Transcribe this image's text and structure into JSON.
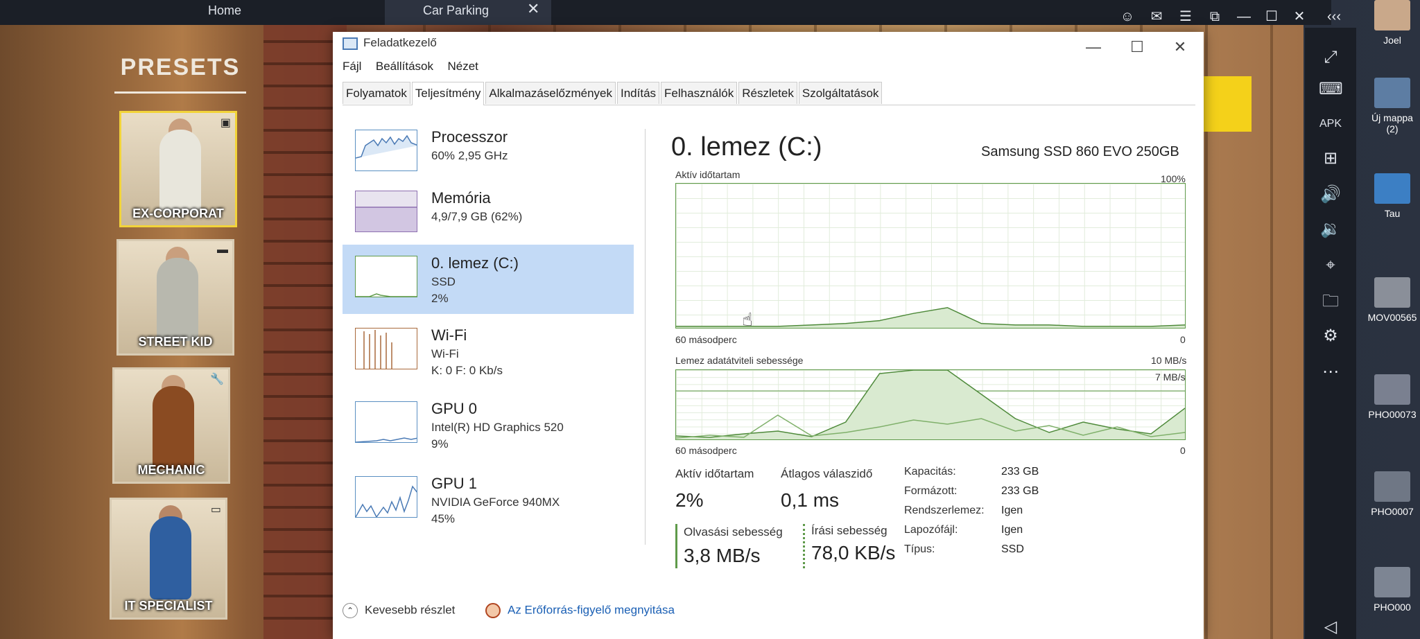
{
  "emulator": {
    "tab_home": "Home",
    "tab_game": "Car Parking",
    "close_glyph": "✕",
    "controls": [
      "☺",
      "✉",
      "☰",
      "⧉",
      "—",
      "☐",
      "✕",
      "‹‹‹"
    ]
  },
  "desktop_icons": [
    {
      "label": "Joel"
    },
    {
      "label": "Új mappa (2)"
    },
    {
      "label": "Tau"
    },
    {
      "label": "MOV00565"
    },
    {
      "label": "PHO00073"
    },
    {
      "label": "PHO0007"
    },
    {
      "label": "PHO000"
    }
  ],
  "game": {
    "presets_title": "PRESETS",
    "presets": [
      {
        "label": "EX-CORPORAT"
      },
      {
        "label": "STREET KID"
      },
      {
        "label": "MECHANIC"
      },
      {
        "label": "IT SPECIALIST"
      }
    ]
  },
  "taskmanager": {
    "title": "Feladatkezelő",
    "menu": [
      "Fájl",
      "Beállítások",
      "Nézet"
    ],
    "tabs": [
      "Folyamatok",
      "Teljesítmény",
      "Alkalmazáselőzmények",
      "Indítás",
      "Felhasználók",
      "Részletek",
      "Szolgáltatások"
    ],
    "active_tab": "Teljesítmény",
    "resources": [
      {
        "name": "Processzor",
        "sub": "60% 2,95 GHz",
        "sub2": ""
      },
      {
        "name": "Memória",
        "sub": "4,9/7,9 GB (62%)",
        "sub2": ""
      },
      {
        "name": "0. lemez (C:)",
        "sub": "SSD",
        "sub2": "2%"
      },
      {
        "name": "Wi-Fi",
        "sub": "Wi-Fi",
        "sub2": "K: 0 F: 0 Kb/s"
      },
      {
        "name": "GPU 0",
        "sub": "Intel(R) HD Graphics 520",
        "sub2": "9%"
      },
      {
        "name": "GPU 1",
        "sub": "NVIDIA GeForce 940MX",
        "sub2": "45%"
      }
    ],
    "selected_resource": 2,
    "detail": {
      "title": "0. lemez (C:)",
      "model": "Samsung SSD 860 EVO 250GB",
      "chart1_label": "Aktív időtartam",
      "chart1_max": "100%",
      "chart1_left": "60 másodperc",
      "chart1_right": "0",
      "chart2_label": "Lemez adatátviteli sebessége",
      "chart2_max": "10 MB/s",
      "chart2_line": "7 MB/s",
      "chart2_left": "60 másodperc",
      "chart2_right": "0",
      "active_label": "Aktív időtartam",
      "active_value": "2%",
      "avg_label": "Átlagos válaszidő",
      "avg_value": "0,1 ms",
      "read_label": "Olvasási sebesség",
      "read_value": "3,8 MB/s",
      "write_label": "Írási sebesség",
      "write_value": "78,0 KB/s",
      "properties": [
        {
          "key": "Kapacitás:",
          "value": "233 GB"
        },
        {
          "key": "Formázott:",
          "value": "233 GB"
        },
        {
          "key": "Rendszerlemez:",
          "value": "Igen"
        },
        {
          "key": "Lapozófájl:",
          "value": "Igen"
        },
        {
          "key": "Típus:",
          "value": "SSD"
        }
      ]
    },
    "footer_less": "Kevesebb részlet",
    "footer_link": "Az Erőforrás-figyelő megnyitása"
  },
  "chart_data": [
    {
      "type": "area",
      "title": "Aktív időtartam",
      "xlabel": "60 másodperc",
      "ylim": [
        0,
        100
      ],
      "y_unit": "%",
      "x": [
        60,
        56,
        52,
        48,
        44,
        40,
        36,
        32,
        28,
        24,
        20,
        16,
        12,
        8,
        4,
        0
      ],
      "values": [
        1,
        1,
        1,
        1,
        2,
        3,
        5,
        10,
        14,
        3,
        2,
        2,
        1,
        1,
        1,
        2
      ]
    },
    {
      "type": "line",
      "title": "Lemez adatátviteli sebessége",
      "xlabel": "60 másodperc",
      "ylim": [
        0,
        10
      ],
      "y_unit": "MB/s",
      "x": [
        60,
        56,
        52,
        48,
        44,
        40,
        36,
        32,
        28,
        24,
        20,
        16,
        12,
        8,
        4,
        0
      ],
      "series": [
        {
          "values": [
            0.5,
            0.3,
            0.8,
            1.2,
            0.4,
            2.5,
            9.5,
            10,
            10,
            6.5,
            3.0,
            1.0,
            2.5,
            1.5,
            0.8,
            4.5
          ]
        },
        {
          "values": [
            0.2,
            0.6,
            0.3,
            3.5,
            0.5,
            1.0,
            1.8,
            2.8,
            2.2,
            3.0,
            1.2,
            2.0,
            0.6,
            1.8,
            0.4,
            1.0
          ]
        }
      ]
    }
  ]
}
